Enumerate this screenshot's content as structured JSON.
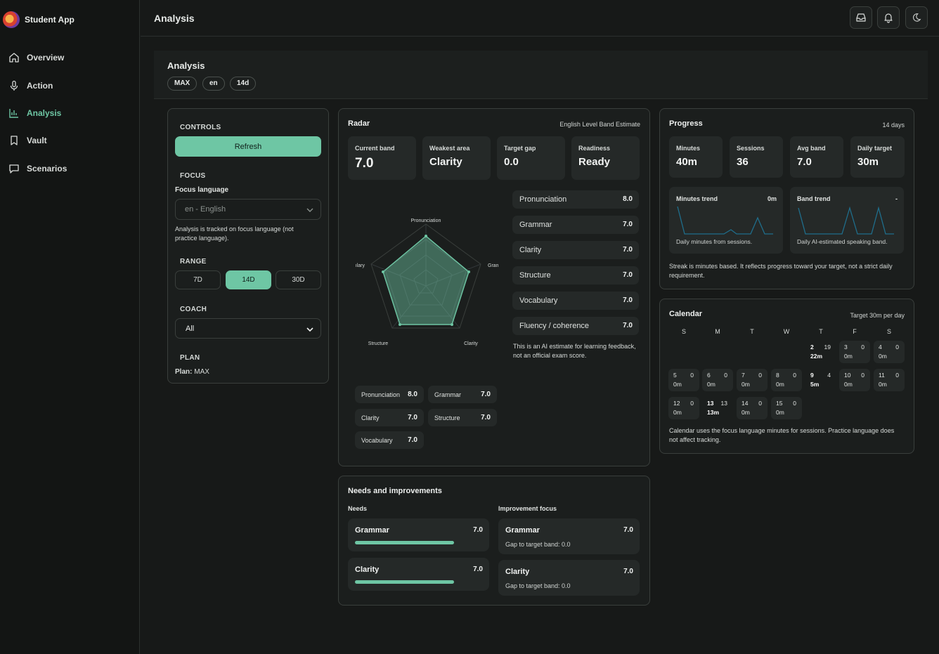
{
  "app": {
    "name": "Student App"
  },
  "nav": {
    "items": [
      {
        "label": "Overview",
        "icon": "home-icon"
      },
      {
        "label": "Action",
        "icon": "mic-icon"
      },
      {
        "label": "Analysis",
        "icon": "bar-chart-icon",
        "active": true
      },
      {
        "label": "Vault",
        "icon": "bookmark-icon"
      },
      {
        "label": "Scenarios",
        "icon": "chat-icon"
      }
    ]
  },
  "topbar": {
    "title": "Analysis",
    "buttons": [
      "inbox-icon",
      "bell-icon",
      "moon-icon"
    ]
  },
  "header": {
    "title": "Analysis",
    "pills": [
      "MAX",
      "en",
      "14d"
    ]
  },
  "controls": {
    "heading": "CONTROLS",
    "refresh": "Refresh",
    "focus_heading": "FOCUS",
    "focus_label": "Focus language",
    "focus_value": "en - English",
    "focus_note": "Analysis is tracked on focus language (not practice language).",
    "range_heading": "RANGE",
    "ranges": [
      "7D",
      "14D",
      "30D"
    ],
    "range_selected": "14D",
    "coach_heading": "COACH",
    "coach_value": "All",
    "plan_heading": "PLAN",
    "plan_label": "Plan:",
    "plan_value": "MAX"
  },
  "radar": {
    "title": "Radar",
    "subtitle": "English Level Band Estimate",
    "stats": [
      {
        "label": "Current band",
        "value": "7.0"
      },
      {
        "label": "Weakest area",
        "value": "Clarity"
      },
      {
        "label": "Target gap",
        "value": "0.0"
      },
      {
        "label": "Readiness",
        "value": "Ready"
      }
    ],
    "axes_shown": [
      "Pronunciation",
      "Gran",
      "Clarity",
      "Structure",
      "ılary"
    ],
    "scores": [
      {
        "name": "Pronunciation",
        "value": "8.0"
      },
      {
        "name": "Grammar",
        "value": "7.0"
      },
      {
        "name": "Clarity",
        "value": "7.0"
      },
      {
        "name": "Structure",
        "value": "7.0"
      },
      {
        "name": "Vocabulary",
        "value": "7.0"
      },
      {
        "name": "Fluency / coherence",
        "value": "7.0"
      }
    ],
    "note": "This is an AI estimate for learning feedback, not an official exam score.",
    "chips": [
      {
        "name": "Pronunciation",
        "value": "8.0"
      },
      {
        "name": "Grammar",
        "value": "7.0"
      },
      {
        "name": "Clarity",
        "value": "7.0"
      },
      {
        "name": "Structure",
        "value": "7.0"
      },
      {
        "name": "Vocabulary",
        "value": "7.0"
      }
    ]
  },
  "progress": {
    "title": "Progress",
    "period": "14 days",
    "stats": [
      {
        "label": "Minutes",
        "value": "40m"
      },
      {
        "label": "Sessions",
        "value": "36"
      },
      {
        "label": "Avg band",
        "value": "7.0"
      },
      {
        "label": "Daily target",
        "value": "30m"
      }
    ],
    "minutes_trend": {
      "title": "Minutes trend",
      "value": "0m",
      "caption": "Daily minutes from sessions."
    },
    "band_trend": {
      "title": "Band trend",
      "value": "-",
      "caption": "Daily AI-estimated speaking band."
    },
    "note": "Streak is minutes based. It reflects progress toward your target, not a strict daily requirement."
  },
  "calendar": {
    "title": "Calendar",
    "target": "Target 30m per day",
    "weekdays": [
      "S",
      "M",
      "T",
      "W",
      "T",
      "F",
      "S"
    ],
    "days": [
      {
        "day": "2",
        "sessions": "19",
        "minutes": "22m"
      },
      {
        "day": "3",
        "sessions": "0",
        "minutes": "0m"
      },
      {
        "day": "4",
        "sessions": "0",
        "minutes": "0m"
      },
      {
        "day": "5",
        "sessions": "0",
        "minutes": "0m"
      },
      {
        "day": "6",
        "sessions": "0",
        "minutes": "0m"
      },
      {
        "day": "7",
        "sessions": "0",
        "minutes": "0m"
      },
      {
        "day": "8",
        "sessions": "0",
        "minutes": "0m"
      },
      {
        "day": "9",
        "sessions": "4",
        "minutes": "5m"
      },
      {
        "day": "10",
        "sessions": "0",
        "minutes": "0m"
      },
      {
        "day": "11",
        "sessions": "0",
        "minutes": "0m"
      },
      {
        "day": "12",
        "sessions": "0",
        "minutes": "0m"
      },
      {
        "day": "13",
        "sessions": "13",
        "minutes": "13m"
      },
      {
        "day": "14",
        "sessions": "0",
        "minutes": "0m"
      },
      {
        "day": "15",
        "sessions": "0",
        "minutes": "0m"
      }
    ],
    "note": "Calendar uses the focus language minutes for sessions. Practice language does not affect tracking."
  },
  "needs": {
    "title": "Needs and improvements",
    "needs_heading": "Needs",
    "focus_heading": "Improvement focus",
    "needs": [
      {
        "name": "Grammar",
        "value": "7.0",
        "progress": 0.7
      },
      {
        "name": "Clarity",
        "value": "7.0",
        "progress": 0.7
      }
    ],
    "focus": [
      {
        "name": "Grammar",
        "value": "7.0",
        "gap": "Gap to target band: 0.0"
      },
      {
        "name": "Clarity",
        "value": "7.0",
        "gap": "Gap to target band: 0.0"
      }
    ]
  },
  "colors": {
    "accent": "#6ec6a4",
    "background": "#171918",
    "card": "#1b1e1d",
    "tile": "#252928",
    "trend_line": "#1f6e8c"
  }
}
